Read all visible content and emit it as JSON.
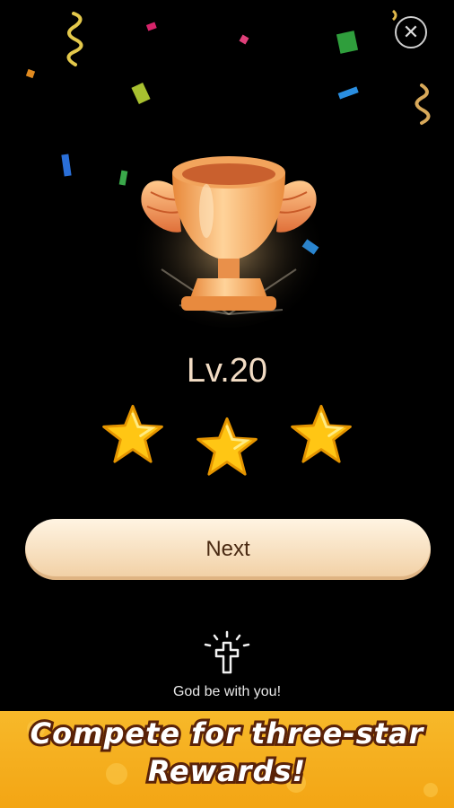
{
  "result": {
    "level_label": "Lv.20",
    "stars_earned": 3,
    "stars_total": 3
  },
  "actions": {
    "next_label": "Next"
  },
  "blessing": {
    "text": "God be with you!",
    "icon": "cross-icon"
  },
  "banner": {
    "line1": "Compete for three-star",
    "line2": "Rewards!"
  },
  "colors": {
    "background": "#000000",
    "button": "#f6e0c2",
    "banner": "#f5ad1a",
    "star": "#ffc20e",
    "trophy": "#f4a95a"
  }
}
